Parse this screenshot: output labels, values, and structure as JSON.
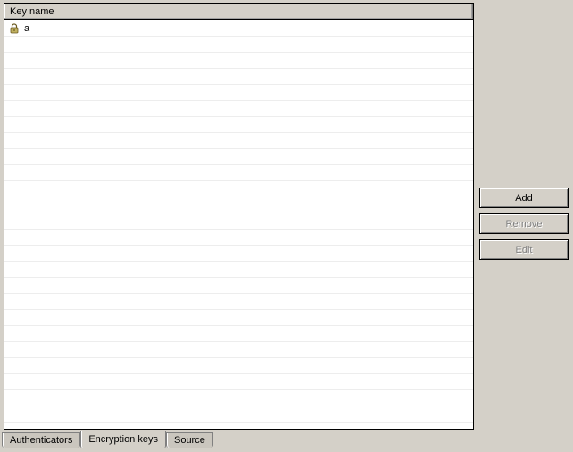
{
  "list": {
    "header": "Key name",
    "items": [
      {
        "icon": "lock-icon",
        "label": "a"
      }
    ]
  },
  "buttons": {
    "add": "Add",
    "remove": "Remove",
    "edit": "Edit"
  },
  "tabs": [
    {
      "label": "Authenticators",
      "active": false
    },
    {
      "label": "Encryption keys",
      "active": true
    },
    {
      "label": "Source",
      "active": false
    }
  ]
}
